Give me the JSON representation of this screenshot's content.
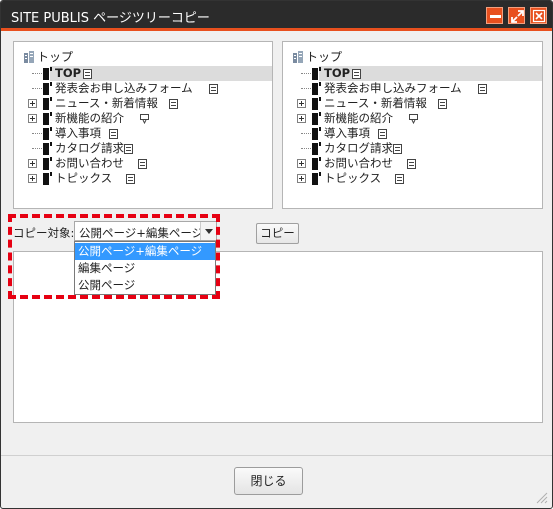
{
  "window": {
    "title": "SITE PUBLIS ページツリーコピー",
    "accent_color": "#e8501e",
    "titlebar_color": "#2b2b2b",
    "controls": {
      "minimize_icon": "minimize-icon",
      "maximize_icon": "maximize-icon",
      "close_icon": "close-icon"
    }
  },
  "source_tree": {
    "root_label": "トップ",
    "items": [
      {
        "label": "TOP",
        "bold": true,
        "selected": true,
        "expandable": false
      },
      {
        "label": "発表会お申し込みフォーム",
        "expandable": false
      },
      {
        "label": "ニュース・新着情報",
        "expandable": true
      },
      {
        "label": "新機能の紹介",
        "expandable": true
      },
      {
        "label": "導入事項",
        "expandable": false
      },
      {
        "label": "カタログ請求",
        "expandable": false
      },
      {
        "label": "お問い合わせ",
        "expandable": true
      },
      {
        "label": "トピックス",
        "expandable": true
      }
    ]
  },
  "target_tree": {
    "root_label": "トップ",
    "items": [
      {
        "label": "TOP",
        "bold": true,
        "selected": true,
        "expandable": false
      },
      {
        "label": "発表会お申し込みフォーム",
        "expandable": false
      },
      {
        "label": "ニュース・新着情報",
        "expandable": true
      },
      {
        "label": "新機能の紹介",
        "expandable": true
      },
      {
        "label": "導入事項",
        "expandable": false
      },
      {
        "label": "カタログ請求",
        "expandable": false
      },
      {
        "label": "お問い合わせ",
        "expandable": true
      },
      {
        "label": "トピックス",
        "expandable": true
      }
    ]
  },
  "copy_target": {
    "label": "コピー対象:",
    "selected_value": "公開ページ+編集ページ",
    "options": [
      "公開ページ+編集ページ",
      "編集ページ",
      "公開ページ"
    ],
    "highlight_color": "#e60012"
  },
  "copy_button_label": "コピー",
  "close_button_label": "閉じる"
}
